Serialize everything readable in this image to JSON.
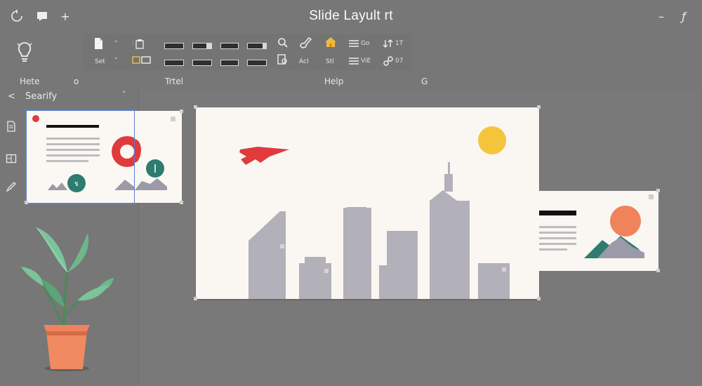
{
  "window": {
    "title": "Slide Layult rt",
    "minimize_glyph": "–",
    "extra_glyph": "ƒ"
  },
  "quick_access": [
    {
      "icon": "undo-circle-icon"
    },
    {
      "icon": "chat-bubble-icon"
    },
    {
      "icon": "plus-icon",
      "glyph": "+"
    }
  ],
  "ribbon": {
    "row1": [
      {
        "icon": "document-icon"
      },
      {
        "icon": "chevron-down-icon",
        "glyph": "˅"
      },
      {
        "icon": "paste-icon",
        "glyph": "⫶"
      },
      {
        "icon": "format-bar-icon"
      },
      {
        "icon": "format-bar-icon"
      },
      {
        "icon": "format-bar-icon"
      },
      {
        "icon": "format-bar-icon"
      },
      {
        "icon": "search-icon",
        "glyph": "⌕"
      },
      {
        "icon": "brush-icon"
      },
      {
        "icon": "home-icon"
      },
      {
        "icon": "list-icon",
        "label": "Go"
      },
      {
        "icon": "sort-icon",
        "label": "1T"
      }
    ],
    "row2": [
      {
        "label": "Set"
      },
      {
        "icon": "chevron-down-icon",
        "glyph": "˅"
      },
      {
        "icon": "shape-icon"
      },
      {
        "icon": "format-bar-icon"
      },
      {
        "icon": "format-bar-icon"
      },
      {
        "icon": "format-bar-icon"
      },
      {
        "icon": "format-bar-icon"
      },
      {
        "icon": "doc-search-icon"
      },
      {
        "label": "Acl"
      },
      {
        "label": "Stl"
      },
      {
        "icon": "list-icon",
        "label": "ViE"
      },
      {
        "icon": "link-icon",
        "label": "07"
      }
    ]
  },
  "groups": {
    "g1": "Hete",
    "g1_icon": "o",
    "g2": "Trtel",
    "g3": "Help",
    "g3_icon": "G"
  },
  "sidebar": {
    "back_glyph": "<",
    "search_value": "Searify",
    "dropdown_glyph": "˅"
  },
  "colors": {
    "background": "#777777",
    "slide_bg": "#faf7f3",
    "accent_red": "#e03a3c",
    "accent_orange": "#f0825c",
    "accent_yellow": "#f4c43a",
    "teal": "#2e7b70",
    "building_gray": "#b2b0b8",
    "selection_blue": "#5f7fc9"
  }
}
